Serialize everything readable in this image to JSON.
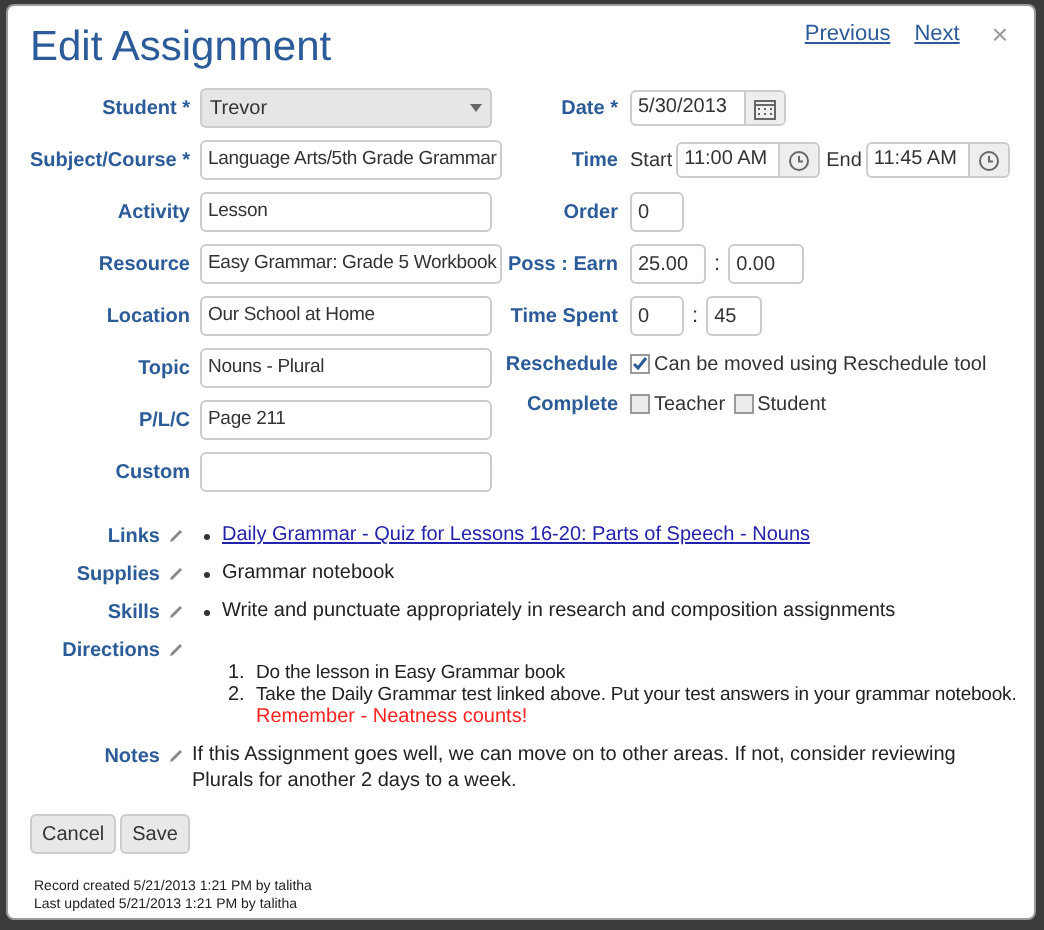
{
  "dialog": {
    "title": "Edit Assignment",
    "nav_links": [
      "Previous",
      "Next"
    ],
    "close": "×"
  },
  "left_fields": [
    {
      "kind": "select",
      "label": "Student *",
      "value": "Trevor"
    },
    {
      "kind": "text",
      "label": "Subject/Course *",
      "value": "Language Arts/5th Grade Grammar"
    },
    {
      "kind": "text",
      "label": "Activity",
      "value": "Lesson"
    },
    {
      "kind": "text",
      "label": "Resource",
      "value": "Easy Grammar: Grade 5 Workbook"
    },
    {
      "kind": "text",
      "label": "Location",
      "value": "Our School at Home"
    },
    {
      "kind": "text",
      "label": "Topic",
      "value": "Nouns - Plural"
    },
    {
      "kind": "text",
      "label": "P/L/C",
      "value": "Page 211"
    },
    {
      "kind": "text",
      "label": "Custom"
    }
  ],
  "right_fields": [
    {
      "kind": "date",
      "label": "Date *",
      "value": "5/30/2013"
    },
    {
      "kind": "time_range",
      "label": "Time",
      "start_label": "Start",
      "start": "11:00 AM",
      "end_label": "End",
      "end": "11:45 AM"
    },
    {
      "kind": "short",
      "label": "Order",
      "value": "0"
    },
    {
      "kind": "pair",
      "label": "Poss : Earn",
      "values": [
        "25.00",
        "0.00"
      ],
      "separator": ":"
    },
    {
      "kind": "pair",
      "label": "Time Spent",
      "values": [
        "0",
        "45"
      ],
      "separator": ":"
    },
    {
      "kind": "checks",
      "label": "Reschedule",
      "options": [
        {
          "label": "Can be moved using Reschedule tool",
          "checked": true
        }
      ]
    },
    {
      "kind": "checks",
      "label": "Complete",
      "options": [
        {
          "label": "Teacher",
          "checked": false
        },
        {
          "label": "Student",
          "checked": false
        }
      ]
    }
  ],
  "sections": [
    {
      "kind": "links",
      "label": "Links",
      "items": [
        "Daily Grammar - Quiz for Lessons 16-20: Parts of Speech - Nouns"
      ]
    },
    {
      "kind": "bullets",
      "label": "Supplies",
      "items": [
        "Grammar notebook"
      ]
    },
    {
      "kind": "bullets",
      "label": "Skills",
      "items": [
        "Write and punctuate appropriately in research and composition assignments"
      ]
    },
    {
      "kind": "numbered",
      "label": "Directions",
      "items": [
        {
          "number": "1.",
          "text": "Do the lesson in Easy Grammar book"
        },
        {
          "number": "2.",
          "text": "Take the Daily Grammar test linked above. Put your test answers in your grammar notebook.",
          "remark": "Remember - Neatness counts!"
        }
      ]
    },
    {
      "kind": "text",
      "label": "Notes",
      "text": "If this Assignment goes well, we can move on to other areas. If not, consider reviewing Plurals for another 2 days to a week."
    }
  ],
  "buttons": [
    "Cancel",
    "Save"
  ],
  "footer": [
    "Record created 5/21/2013 1:21 PM by talitha",
    "Last updated 5/21/2013 1:21 PM by talitha"
  ]
}
